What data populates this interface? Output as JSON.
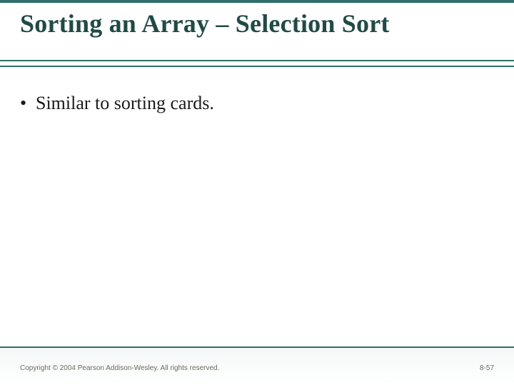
{
  "slide": {
    "title": "Sorting an Array – Selection Sort",
    "bullets": [
      "Similar to sorting cards."
    ],
    "footer": {
      "copyright": "Copyright © 2004 Pearson Addison-Wesley. All rights reserved.",
      "page_label": "8-57"
    }
  }
}
